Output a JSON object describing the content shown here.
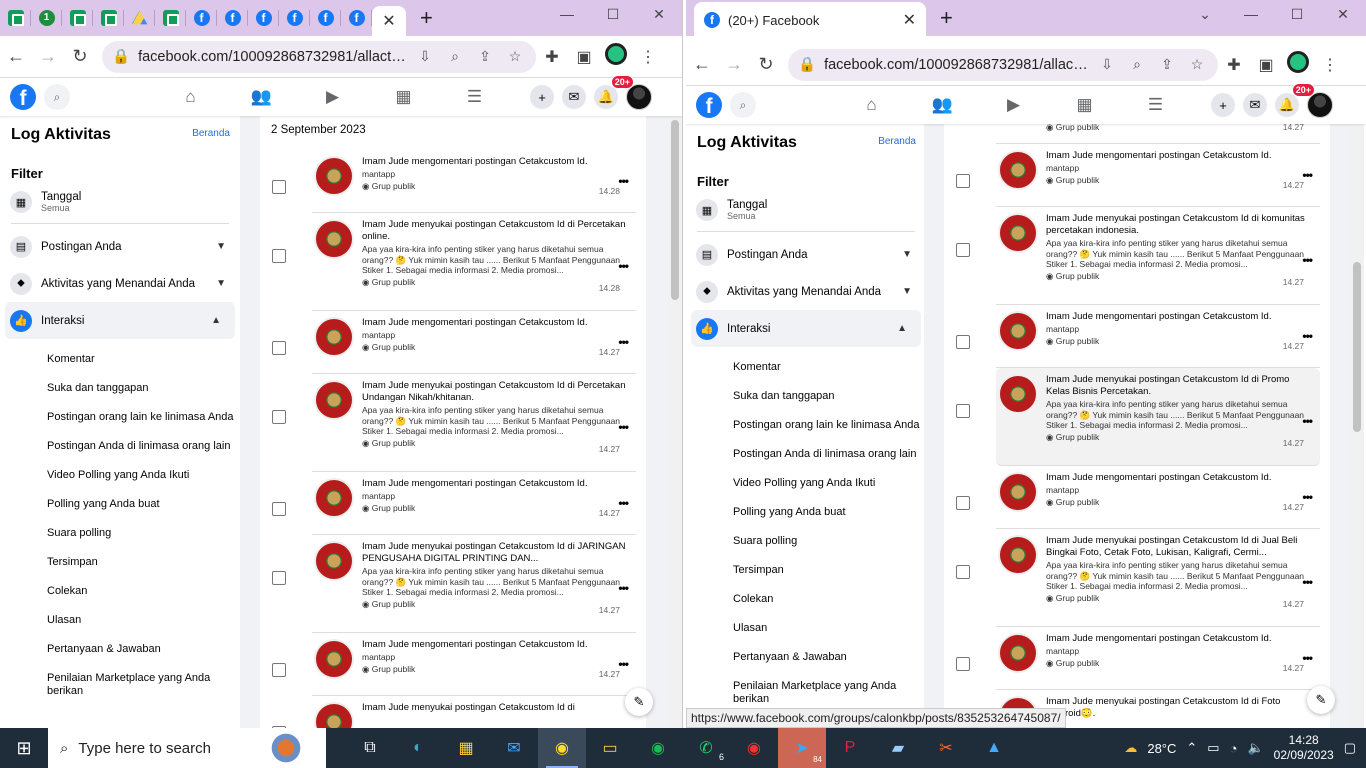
{
  "left": {
    "url": "facebook.com/100092868732981/allactivi...",
    "tabs": [
      "sheets",
      "whatsapp",
      "sheets",
      "sheets",
      "drive",
      "sheets",
      "facebook",
      "facebook",
      "facebook",
      "facebook",
      "facebook",
      "facebook"
    ],
    "badge": "20+",
    "sidebar": {
      "title": "Log Aktivitas",
      "beranda": "Beranda",
      "filter": "Filter",
      "tanggal": "Tanggal",
      "tanggal_sub": "Semua",
      "items": [
        "Postingan Anda",
        "Aktivitas yang Menandai Anda",
        "Interaksi"
      ],
      "subitems": [
        "Komentar",
        "Suka dan tanggapan",
        "Postingan orang lain ke linimasa Anda",
        "Postingan Anda di linimasa orang lain",
        "Video Polling yang Anda Ikuti",
        "Polling yang Anda buat",
        "Suara polling",
        "Tersimpan",
        "Colekan",
        "Ulasan",
        "Pertanyaan & Jawaban",
        "Penilaian Marketplace yang Anda berikan"
      ]
    },
    "date": "2 September 2023",
    "entries": [
      {
        "title": "Imam Jude mengomentari postingan Cetakcustom Id.",
        "snippet": "mantapp",
        "meta": "Grup publik",
        "time": "14.28"
      },
      {
        "title": "Imam Jude menyukai postingan Cetakcustom Id di Percetakan online.",
        "snippet": "Apa yaa kira-kira info penting stiker yang harus diketahui semua orang?? 🤔 Yuk mimin kasih tau ...... Berikut 5 Manfaat Penggunaan Stiker 1. Sebagai media informasi 2. Media promosi...",
        "meta": "Grup publik",
        "time": "14.28"
      },
      {
        "title": "Imam Jude mengomentari postingan Cetakcustom Id.",
        "snippet": "mantapp",
        "meta": "Grup publik",
        "time": "14.27"
      },
      {
        "title": "Imam Jude menyukai postingan Cetakcustom Id di Percetakan Undangan Nikah/khitanan.",
        "snippet": "Apa yaa kira-kira info penting stiker yang harus diketahui semua orang?? 🤔 Yuk mimin kasih tau ...... Berikut 5 Manfaat Penggunaan Stiker 1. Sebagai media informasi 2. Media promosi...",
        "meta": "Grup publik",
        "time": "14.27"
      },
      {
        "title": "Imam Jude mengomentari postingan Cetakcustom Id.",
        "snippet": "mantapp",
        "meta": "Grup publik",
        "time": "14.27"
      },
      {
        "title": "Imam Jude menyukai postingan Cetakcustom Id di JARINGAN PENGUSAHA DIGITAL PRINTING DAN...",
        "snippet": "Apa yaa kira-kira info penting stiker yang harus diketahui semua orang?? 🤔 Yuk mimin kasih tau ...... Berikut 5 Manfaat Penggunaan Stiker 1. Sebagai media informasi 2. Media promosi...",
        "meta": "Grup publik",
        "time": "14.27"
      },
      {
        "title": "Imam Jude mengomentari postingan Cetakcustom Id.",
        "snippet": "mantapp",
        "meta": "Grup publik",
        "time": "14.27"
      },
      {
        "title": "Imam Jude menyukai postingan Cetakcustom Id di",
        "snippet": "",
        "meta": "",
        "time": ""
      }
    ]
  },
  "right": {
    "tab_title": "(20+) Facebook",
    "url": "facebook.com/100092868732981/allactiv...",
    "badge": "20+",
    "top_meta": "Grup publik",
    "top_time": "14.27",
    "entries": [
      {
        "title": "Imam Jude mengomentari postingan Cetakcustom Id.",
        "snippet": "mantapp",
        "meta": "Grup publik",
        "time": "14.27"
      },
      {
        "title": "Imam Jude menyukai postingan Cetakcustom Id di komunitas percetakan indonesia.",
        "snippet": "Apa yaa kira-kira info penting stiker yang harus diketahui semua orang?? 🤔 Yuk mimin kasih tau ...... Berikut 5 Manfaat Penggunaan Stiker 1. Sebagai media informasi 2. Media promosi...",
        "meta": "Grup publik",
        "time": "14.27"
      },
      {
        "title": "Imam Jude mengomentari postingan Cetakcustom Id.",
        "snippet": "mantapp",
        "meta": "Grup publik",
        "time": "14.27"
      },
      {
        "title": "Imam Jude menyukai postingan Cetakcustom Id di Promo Kelas Bisnis Percetakan.",
        "snippet": "Apa yaa kira-kira info penting stiker yang harus diketahui semua orang?? 🤔 Yuk mimin kasih tau ...... Berikut 5 Manfaat Penggunaan Stiker 1. Sebagai media informasi 2. Media promosi...",
        "meta": "Grup publik",
        "time": "14.27"
      },
      {
        "title": "Imam Jude mengomentari postingan Cetakcustom Id.",
        "snippet": "mantapp",
        "meta": "Grup publik",
        "time": "14.27"
      },
      {
        "title": "Imam Jude menyukai postingan Cetakcustom Id di Jual Beli Bingkai Foto, Cetak Foto, Lukisan, Kaligrafi, Cermi...",
        "snippet": "Apa yaa kira-kira info penting stiker yang harus diketahui semua orang?? 🤔 Yuk mimin kasih tau ...... Berikut 5 Manfaat Penggunaan Stiker 1. Sebagai media informasi 2. Media promosi...",
        "meta": "Grup publik",
        "time": "14.27"
      },
      {
        "title": "Imam Jude mengomentari postingan Cetakcustom Id.",
        "snippet": "mantapp",
        "meta": "Grup publik",
        "time": "14.27"
      },
      {
        "title": "Imam Jude menyukai postingan Cetakcustom Id di Foto Polaroid😳.",
        "snippet": "",
        "meta": "",
        "time": ""
      }
    ]
  },
  "status_url": "https://www.facebook.com/groups/calonkbp/posts/835253264745087/",
  "taskbar": {
    "search_placeholder": "Type here to search",
    "weather": "28°C",
    "time": "14:28",
    "date": "02/09/2023",
    "whatsapp_count": "6",
    "telegram_count": "84"
  },
  "colors": {
    "fb_blue": "#1877f2",
    "tab_bar": "#dcc7ea",
    "taskbar": "#1f2c3a"
  }
}
